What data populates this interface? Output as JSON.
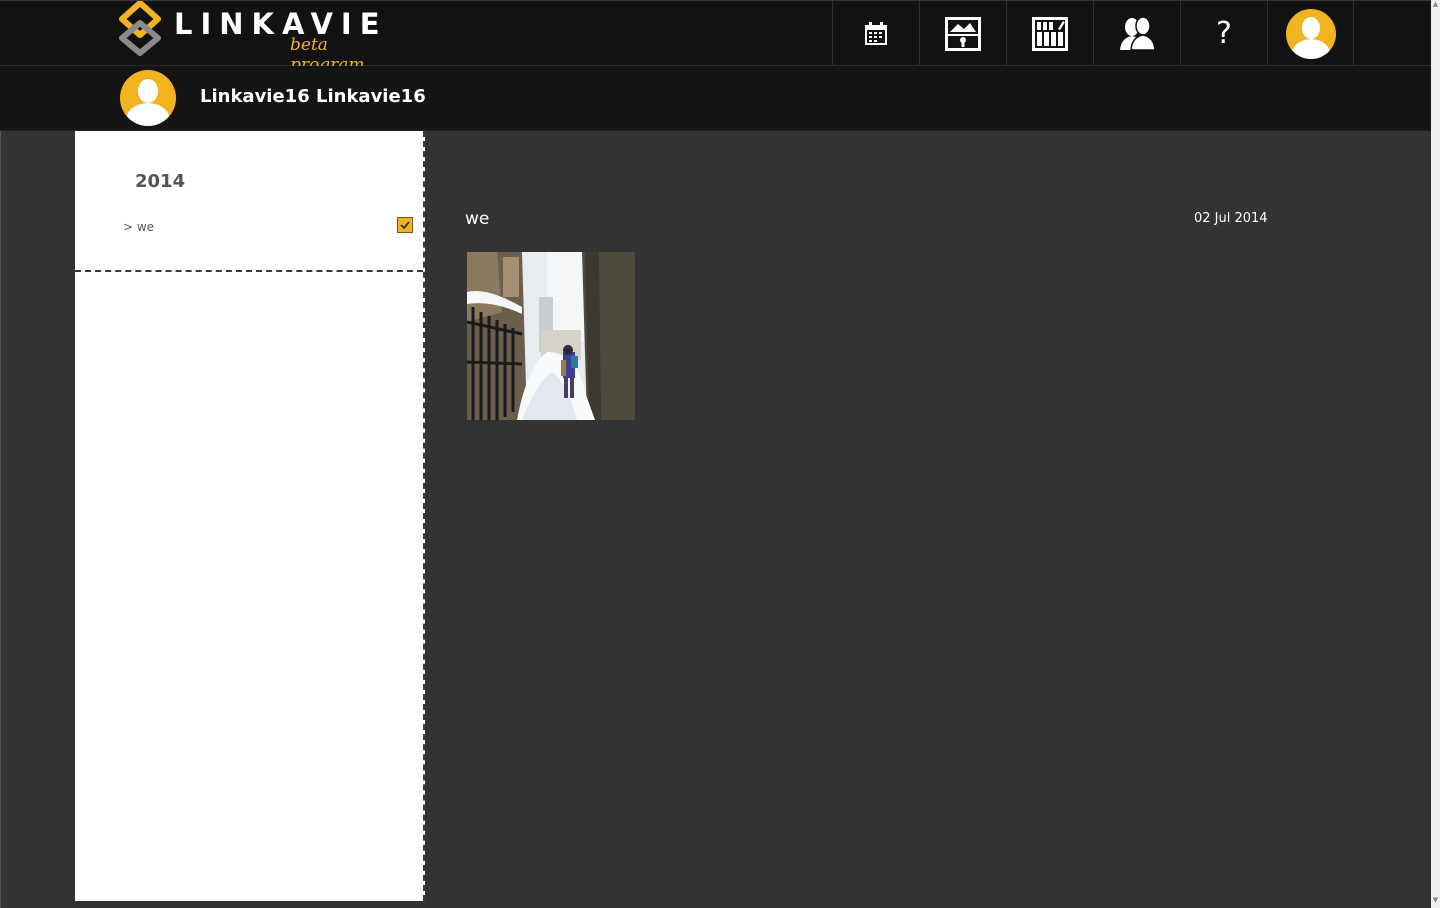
{
  "brand": {
    "name": "LINKAVIE",
    "subtitle": "beta program",
    "accent_color": "#f2b321"
  },
  "nav": {
    "items": [
      {
        "name": "calendar-icon"
      },
      {
        "name": "private-gallery-icon"
      },
      {
        "name": "albums-edit-icon"
      },
      {
        "name": "friends-icon"
      },
      {
        "name": "help-icon",
        "label": "?"
      },
      {
        "name": "user-avatar-icon"
      }
    ]
  },
  "profile": {
    "name": "Linkavie16 Linkavie16"
  },
  "sidebar": {
    "year": "2014",
    "albums": [
      {
        "label": "> we",
        "checked": true
      }
    ]
  },
  "main": {
    "album_title": "we",
    "album_date": "02 Jul 2014"
  }
}
